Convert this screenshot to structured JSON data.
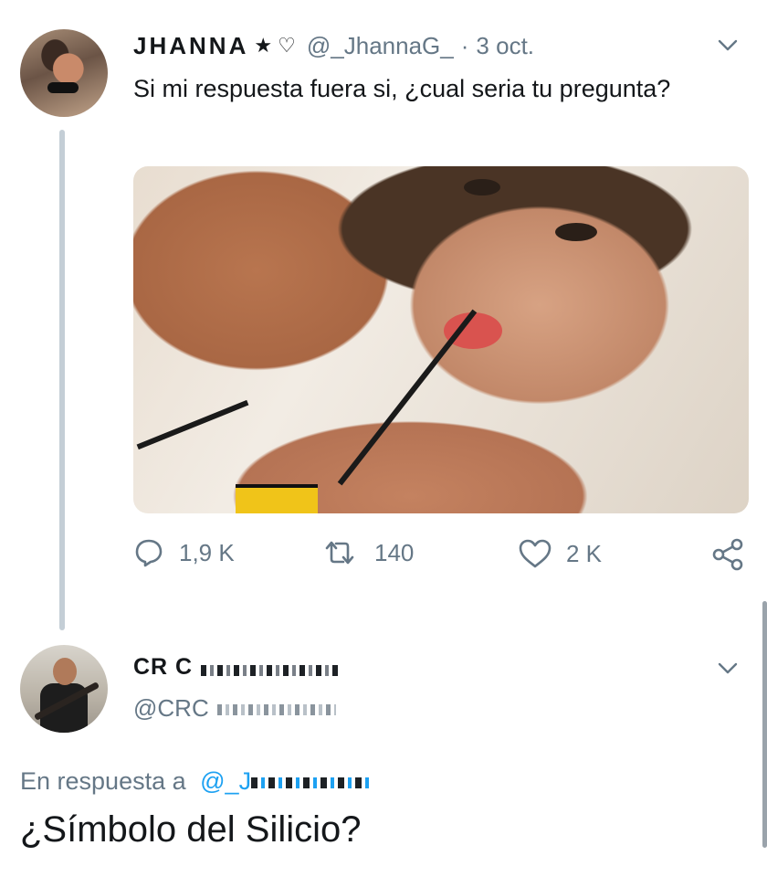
{
  "original_tweet": {
    "display_name": "JHANNA",
    "name_symbols": "★ ♡",
    "handle": "@_JhannaG_",
    "separator": "·",
    "date": "3 oct.",
    "text": "Si mi respuesta fuera si, ¿cual seria tu pregunta?",
    "actions": {
      "reply_count": "1,9 K",
      "retweet_count": "140",
      "like_count": "2 K"
    }
  },
  "reply_tweet": {
    "display_name": "CR C",
    "handle": "@CRC",
    "reply_to_prefix": "En respuesta a",
    "reply_to_handle": "@_J",
    "text": "¿Símbolo del Silicio?"
  },
  "icons": {
    "menu": "chevron-down-icon",
    "reply": "reply-bubble-icon",
    "retweet": "retweet-icon",
    "like": "heart-icon",
    "share": "share-icon"
  },
  "colors": {
    "text": "#14171a",
    "secondary": "#657786",
    "mention": "#1da1f2",
    "thread_line": "#c4ced6"
  }
}
